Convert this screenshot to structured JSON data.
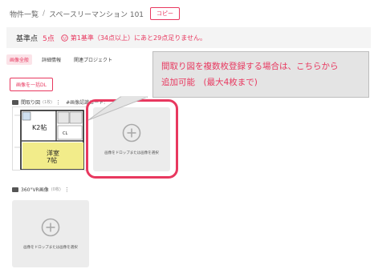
{
  "breadcrumb": {
    "root": "物件一覧",
    "separator": "/",
    "current": "スペースリーマンション 101",
    "copy_label": "コピー"
  },
  "score": {
    "label": "基準点",
    "value": "5点",
    "message": "第1基準（34点以上）にあと29点足りません。",
    "accent": "#e8385f"
  },
  "tabs": [
    {
      "label": "画像全般",
      "active": true
    },
    {
      "label": "詳細情報",
      "active": false
    },
    {
      "label": "関連プロジェクト",
      "active": false
    }
  ],
  "bulk_download_label": "画像を一括DL",
  "floorplan_section": {
    "title": "間取り図",
    "count": "(1枚)",
    "code_label": "#画像認識コード:",
    "thumb_room_k": "K2帖",
    "thumb_room_main": "洋室\n7帖",
    "thumb_room_cl": "CL"
  },
  "dropzone_text": "画像をドロップまたは画像を選択",
  "vr_section": {
    "title": "360°VR画像",
    "count": "(0枚)"
  },
  "callout": {
    "line1": "間取り図を複数枚登録する場合は、こちらから",
    "line2": "追加可能　(最大4枚まで)"
  }
}
